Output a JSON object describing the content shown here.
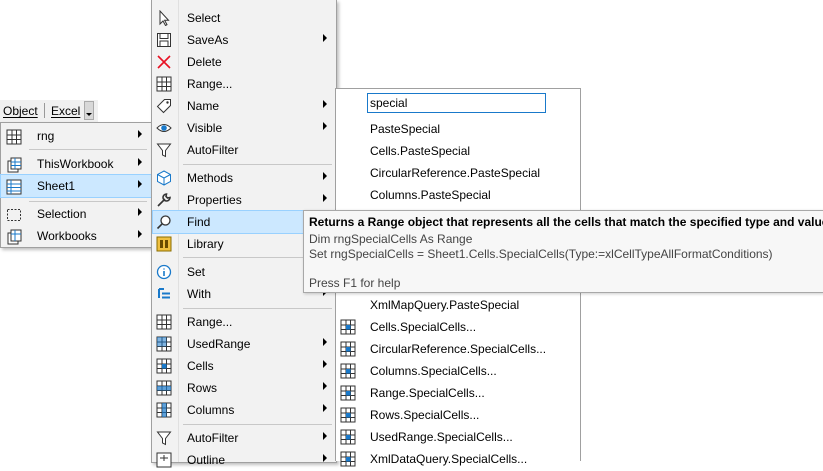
{
  "toolbar": {
    "object": "Object",
    "excel": "Excel"
  },
  "left_menu": {
    "items": [
      {
        "label": "rng",
        "icon": "grid-icon",
        "submenu": true
      },
      {
        "label": "ThisWorkbook",
        "icon": "workbook-icon",
        "submenu": true
      },
      {
        "label": "Sheet1",
        "icon": "sheet-icon",
        "submenu": true,
        "selected": true
      },
      {
        "label": "Selection",
        "icon": "selection-icon",
        "submenu": true
      },
      {
        "label": "Workbooks",
        "icon": "workbooks-icon",
        "submenu": true
      }
    ]
  },
  "main_menu": {
    "items": [
      {
        "label": "Select",
        "icon": "cursor-icon",
        "submenu": false
      },
      {
        "label": "SaveAs",
        "icon": "save-icon",
        "submenu": true
      },
      {
        "label": "Delete",
        "icon": "delete-x-icon",
        "submenu": false
      },
      {
        "label": "Range...",
        "icon": "grid-icon",
        "submenu": false
      },
      {
        "label": "Name",
        "icon": "tag-icon",
        "submenu": true
      },
      {
        "label": "Visible",
        "icon": "eye-icon",
        "submenu": true
      },
      {
        "label": "AutoFilter",
        "icon": "filter-icon",
        "submenu": false
      },
      {
        "label": "Methods",
        "icon": "cube-icon",
        "submenu": true
      },
      {
        "label": "Properties",
        "icon": "wrench-icon",
        "submenu": true
      },
      {
        "label": "Find",
        "icon": "search-icon",
        "submenu": false,
        "highlighted": true
      },
      {
        "label": "Library",
        "icon": "library-icon",
        "submenu": false
      },
      {
        "label": "Set",
        "icon": "info-circle-icon",
        "submenu": false
      },
      {
        "label": "With",
        "icon": "with-block-icon",
        "submenu": true
      },
      {
        "label": "Range...",
        "icon": "grid-icon",
        "submenu": false
      },
      {
        "label": "UsedRange",
        "icon": "used-range-icon",
        "submenu": true
      },
      {
        "label": "Cells",
        "icon": "cells-icon",
        "submenu": true
      },
      {
        "label": "Rows",
        "icon": "rows-icon",
        "submenu": true
      },
      {
        "label": "Columns",
        "icon": "columns-icon",
        "submenu": true
      },
      {
        "label": "AutoFilter",
        "icon": "filter-icon",
        "submenu": true
      },
      {
        "label": "Outline",
        "icon": "outline-icon",
        "submenu": true
      }
    ]
  },
  "search": {
    "value": "special"
  },
  "results": [
    {
      "label": "PasteSpecial",
      "icon": ""
    },
    {
      "label": "Cells.PasteSpecial",
      "icon": ""
    },
    {
      "label": "CircularReference.PasteSpecial",
      "icon": ""
    },
    {
      "label": "Columns.PasteSpecial",
      "icon": ""
    },
    {
      "label": "XmlMapQuery.PasteSpecial",
      "icon": ""
    },
    {
      "label": "Cells.SpecialCells...",
      "icon": "special-cells-icon"
    },
    {
      "label": "CircularReference.SpecialCells...",
      "icon": "special-cells-icon"
    },
    {
      "label": "Columns.SpecialCells...",
      "icon": "special-cells-icon"
    },
    {
      "label": "Range.SpecialCells...",
      "icon": "special-cells-icon"
    },
    {
      "label": "Rows.SpecialCells...",
      "icon": "special-cells-icon"
    },
    {
      "label": "UsedRange.SpecialCells...",
      "icon": "special-cells-icon"
    },
    {
      "label": "XmlDataQuery.SpecialCells...",
      "icon": "special-cells-icon"
    }
  ],
  "tooltip": {
    "title": "Returns a Range object that represents all the cells that match the specified type and value.",
    "line1": "Dim rngSpecialCells As Range",
    "line2": "Set rngSpecialCells = Sheet1.Cells.SpecialCells(Type:=xlCellTypeAllFormatConditions)",
    "help": "Press F1 for help"
  },
  "colors": {
    "highlight": "#cce8ff",
    "highlight_border": "#99d1ff",
    "accent": "#1979ca",
    "delete": "#e81123"
  }
}
